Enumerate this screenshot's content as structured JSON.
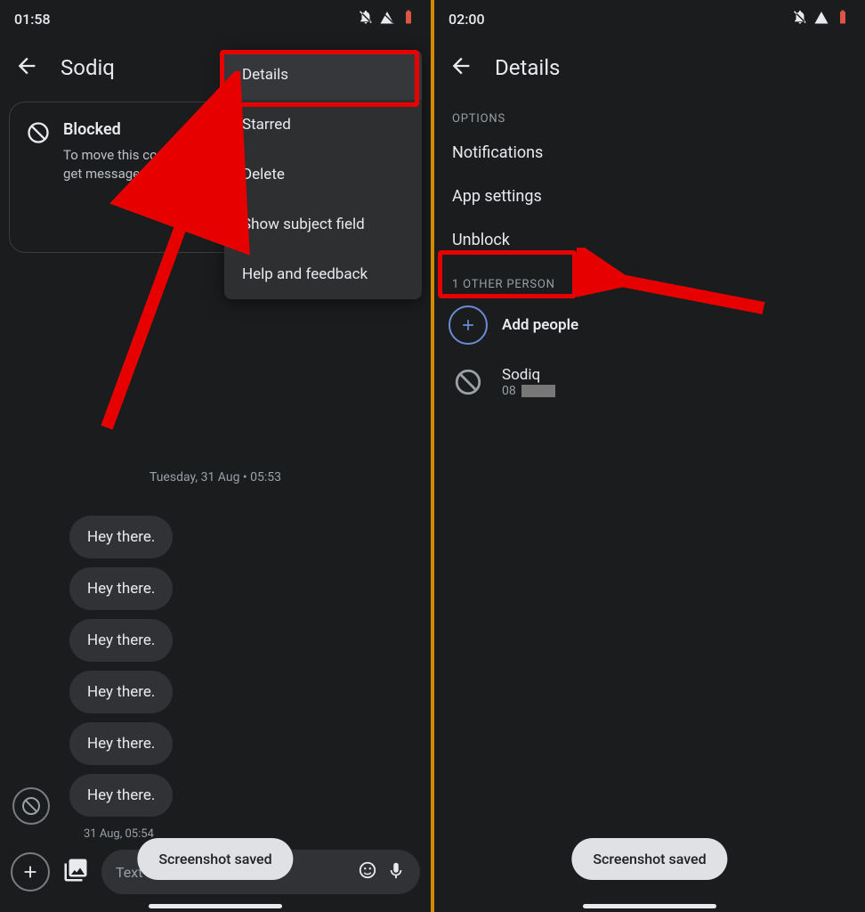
{
  "left": {
    "status_time": "01:58",
    "title": "Sodiq",
    "blocked_title": "Blocked",
    "blocked_sub": "To move this conversation out of 'spam and blocked' and get messages again, unblock.",
    "menu": [
      "Details",
      "Starred",
      "Delete",
      "Show subject field",
      "Help and feedback"
    ],
    "date_divider": "Tuesday, 31 Aug • 05:53",
    "messages": [
      "Hey there.",
      "Hey there.",
      "Hey there.",
      "Hey there.",
      "Hey there.",
      "Hey there."
    ],
    "msg_ts": "31 Aug, 05:54",
    "input_placeholder": "Text message",
    "ss_saved": "Screenshot saved"
  },
  "right": {
    "status_time": "02:00",
    "title": "Details",
    "options_label": "OPTIONS",
    "options": [
      "Notifications",
      "App settings",
      "Unblock"
    ],
    "people_label": "1 OTHER PERSON",
    "add_people": "Add people",
    "person_name": "Sodiq",
    "person_phone_prefix": "08",
    "ss_saved": "Screenshot saved"
  }
}
